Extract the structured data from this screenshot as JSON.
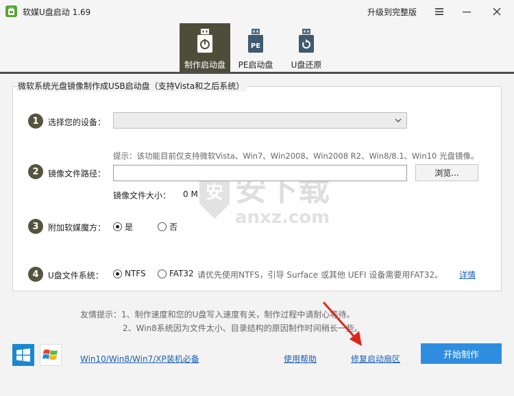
{
  "titlebar": {
    "title": "软媒U盘启动 1.69",
    "upgrade": "升级到完整版"
  },
  "tabs": [
    {
      "label": "制作启动盘",
      "icon": "usb-power-icon",
      "active": true
    },
    {
      "label": "PE启动盘",
      "icon": "usb-pe-icon",
      "active": false,
      "icon_text": "PE"
    },
    {
      "label": "U盘还原",
      "icon": "usb-restore-icon",
      "active": false
    }
  ],
  "group": {
    "title": "微软系统光盘镜像制作成USB启动盘（支持Vista和之后系统）"
  },
  "steps": {
    "device": {
      "number": "1",
      "label": "选择您的设备：",
      "selected": ""
    },
    "image": {
      "number": "2",
      "label": "镜像文件路径：",
      "hint": "提示：该功能目前仅支持微软Vista、Win7、Win2008、Win2008 R2、Win8/8.1、Win10 光盘镜像。",
      "path_value": "",
      "browse": "浏览...",
      "size_label": "镜像文件大小：",
      "size_value": "0 M"
    },
    "magic": {
      "number": "3",
      "label": "附加软媒魔方：",
      "options": [
        "是",
        "否"
      ],
      "selected": "是"
    },
    "fs": {
      "number": "4",
      "label": "U盘文件系统：",
      "options": [
        "NTFS",
        "FAT32"
      ],
      "selected": "NTFS",
      "note": "请优先使用NTFS，引导 Surface 或其他 UEFI 设备需要用FAT32。",
      "detail": "详情"
    }
  },
  "tips": {
    "line1": "友情提示：1、制作速度和您的U盘写入速度有关，制作过程中请耐心等待。",
    "line2": "2、Win8系统因为文件太小、目录结构的原因制作时间稍长一些。"
  },
  "footer": {
    "systems_link": "Win10/Win8/Win7/XP装机必备",
    "help_link": "使用帮助",
    "repair_link": "修复启动扇区",
    "start_button": "开始制作"
  },
  "watermark": {
    "main": "安下载",
    "sub": "anxz.com",
    "badge": "安"
  },
  "colors": {
    "active_tab": "#4d4d3a",
    "step_circle": "#55553f",
    "start_button": "#2e8de0",
    "link": "#1a5fb4",
    "arrow": "#e0241b"
  }
}
